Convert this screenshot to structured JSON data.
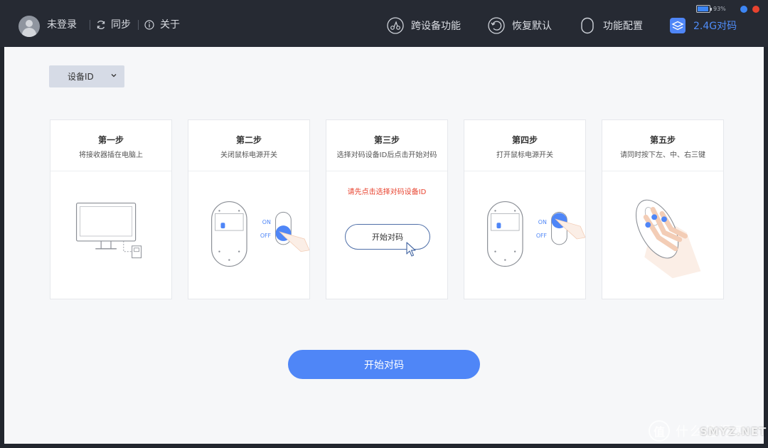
{
  "header": {
    "user_label": "未登录",
    "sync_label": "同步",
    "about_label": "关于",
    "nav": [
      {
        "label": "跨设备功能",
        "icon": "cross-device-icon"
      },
      {
        "label": "恢复默认",
        "icon": "restore-icon"
      },
      {
        "label": "功能配置",
        "icon": "mouse-icon"
      },
      {
        "label": "2.4G对码",
        "icon": "layers-icon",
        "active": true
      }
    ],
    "battery_percent": "93%",
    "battery_level": 0.93,
    "dot_colors": [
      "#3d86f4",
      "#e8432f"
    ]
  },
  "device_select": {
    "label": "设备ID"
  },
  "steps": [
    {
      "title": "第一步",
      "subtitle": "将接收器插在电脑上"
    },
    {
      "title": "第二步",
      "subtitle": "关闭鼠标电源开关",
      "on": "ON",
      "off": "OFF"
    },
    {
      "title": "第三步",
      "subtitle": "选择对码设备ID后点击开始对码",
      "error": "请先点击选择对码设备ID",
      "button": "开始对码"
    },
    {
      "title": "第四步",
      "subtitle": "打开鼠标电源开关",
      "on": "ON",
      "off": "OFF"
    },
    {
      "title": "第五步",
      "subtitle": "请同时按下左、中、右三键"
    }
  ],
  "start_button": "开始对码",
  "watermark": {
    "logo": "值",
    "text": "什么值得买",
    "sub": "SMYZ.NET"
  },
  "colors": {
    "accent": "#4f86f7",
    "error": "#e8432f",
    "topbar": "#262a33"
  }
}
